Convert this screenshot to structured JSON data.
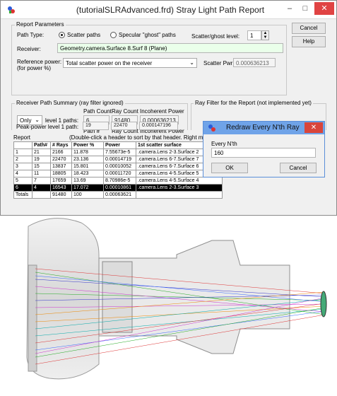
{
  "window": {
    "title": "(tutorialSLRAdvanced.frd) Stray Light Path Report",
    "minimize": "–",
    "maximize": "□",
    "close": "✕"
  },
  "report_parameters": {
    "label": "Report Parameters",
    "path_type_label": "Path Type:",
    "scatter_paths_label": "Scatter paths",
    "specular_paths_label": "Specular \"ghost\" paths",
    "scatter_level_label": "Scatter/ghost level:",
    "scatter_level_value": "1",
    "receiver_label": "Receiver:",
    "receiver_value": "Geometry.camera.Surface 8.Surf 8  (Plane)",
    "reference_power_label": "Reference power:",
    "reference_power_sub": "(for power %)",
    "reference_power_value": "Total scatter power on the receiver",
    "scatter_pwr_label": "Scatter Pwr:",
    "scatter_pwr_value": "0.000636213"
  },
  "buttons": {
    "cancel": "Cancel",
    "help": "Help"
  },
  "summary": {
    "label": "Receiver Path Summary (ray filter ignored)",
    "path_count_header": "Path Count",
    "ray_count_header": "Ray Count",
    "incoherent_power_header": "Incoherent Power",
    "only_value": "Only",
    "level1_label": "level 1 paths:",
    "path_count": "6",
    "ray_count": "91480",
    "incoherent_power": "0.000636213",
    "path_num_header": "Path #",
    "ray_count_header2": "Ray Count",
    "incoherent_power_header2": "Incoherent Power",
    "peak_label": "Peak-power level 1 path:",
    "peak_path": "19",
    "peak_rays": "22470",
    "peak_power": "0.000147196"
  },
  "ray_filter": {
    "label": "Ray Filter for the Report (not implemented yet)"
  },
  "report": {
    "label": "Report",
    "hint": "(Double-click a header to sort by that header.  Right mouse c",
    "headers": [
      "",
      "Path#",
      "# Rays",
      "Power %",
      "Power",
      "1st scatter surface"
    ],
    "rows": [
      [
        "1",
        "21",
        "2166",
        "11.878",
        "7.55673e-5",
        ".camera.Lens 2-3.Surface 2"
      ],
      [
        "2",
        "19",
        "22470",
        "23.136",
        "0.00014719",
        ".camera.Lens 6-7.Surface 7"
      ],
      [
        "3",
        "15",
        "13837",
        "15.801",
        "0.00010052",
        ".camera.Lens 6-7.Surface 6"
      ],
      [
        "4",
        "11",
        "18805",
        "18.423",
        "0.00011720",
        ".camera.Lens 4-5.Surface 5"
      ],
      [
        "5",
        "7",
        "17659",
        "13.69",
        "8.70986e-5",
        ".camera.Lens 4-5.Surface 4"
      ],
      [
        "6",
        "4",
        "16543",
        "17.072",
        "0.00010861",
        ".camera.Lens 2-3.Surface 3"
      ]
    ],
    "totals": [
      "Totals",
      "",
      "91480",
      "100",
      "0.00063621",
      ""
    ]
  },
  "dialog": {
    "title": "Redraw Every N'th Ray",
    "field_label": "Every N'th",
    "field_value": "160",
    "ok": "OK",
    "cancel": "Cancel",
    "close": "✕"
  },
  "colors": {
    "title_blue": "#6fa3e8",
    "close_red": "#e04343",
    "selected_row": "#000000",
    "receiver_field": "#eaffea"
  },
  "icons": [
    "app-logo-icon",
    "spinner-arrows-icon",
    "dropdown-arrow-icon"
  ]
}
